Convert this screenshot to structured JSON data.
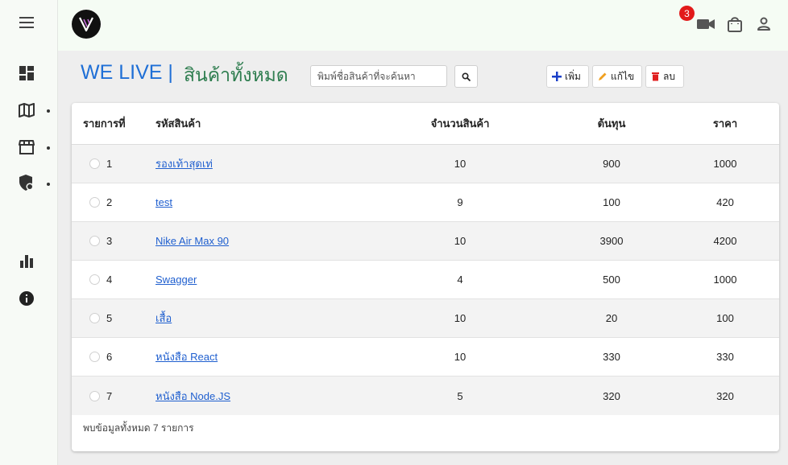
{
  "topbar": {
    "cart_badge": "3",
    "logo_alt": "V"
  },
  "header": {
    "brand": "WE LIVE |",
    "title": "สินค้าทั้งหมด"
  },
  "search": {
    "placeholder": "พิมพ์ชื่อสินค้าที่จะค้นหา",
    "value": ""
  },
  "actions": {
    "add_label": "เพิ่ม",
    "edit_label": "แก้ไข",
    "delete_label": "ลบ"
  },
  "table": {
    "headers": {
      "num": "รายการที่",
      "code": "รหัสสินค้า",
      "qty": "จำนวนสินค้า",
      "cost": "ต้นทุน",
      "price": "ราคา"
    },
    "rows": [
      {
        "num": "1",
        "code": "รองเท้าสุดเท่",
        "qty": "10",
        "cost": "900",
        "price": "1000"
      },
      {
        "num": "2",
        "code": "test",
        "qty": "9",
        "cost": "100",
        "price": "420"
      },
      {
        "num": "3",
        "code": "Nike Air Max 90",
        "qty": "10",
        "cost": "3900",
        "price": "4200"
      },
      {
        "num": "4",
        "code": "Swagger",
        "qty": "4",
        "cost": "500",
        "price": "1000"
      },
      {
        "num": "5",
        "code": "เสื้อ",
        "qty": "10",
        "cost": "20",
        "price": "100"
      },
      {
        "num": "6",
        "code": "หนังสือ React",
        "qty": "10",
        "cost": "330",
        "price": "330"
      },
      {
        "num": "7",
        "code": "หนังสือ Node.JS",
        "qty": "5",
        "cost": "320",
        "price": "320"
      }
    ],
    "footer": "พบข้อมูลทั้งหมด 7 รายการ"
  },
  "colors": {
    "brand": "#1f6fd6",
    "title": "#2e7d4f",
    "badge": "#e21a1a",
    "link": "#1f5fcf"
  },
  "icons": {
    "sidebar": [
      "menu-icon",
      "dashboard-icon",
      "map-icon",
      "store-icon",
      "security-icon",
      "bar-chart-icon",
      "info-icon"
    ],
    "topbar": [
      "video-camera-icon",
      "shopping-bag-icon",
      "person-icon"
    ]
  }
}
